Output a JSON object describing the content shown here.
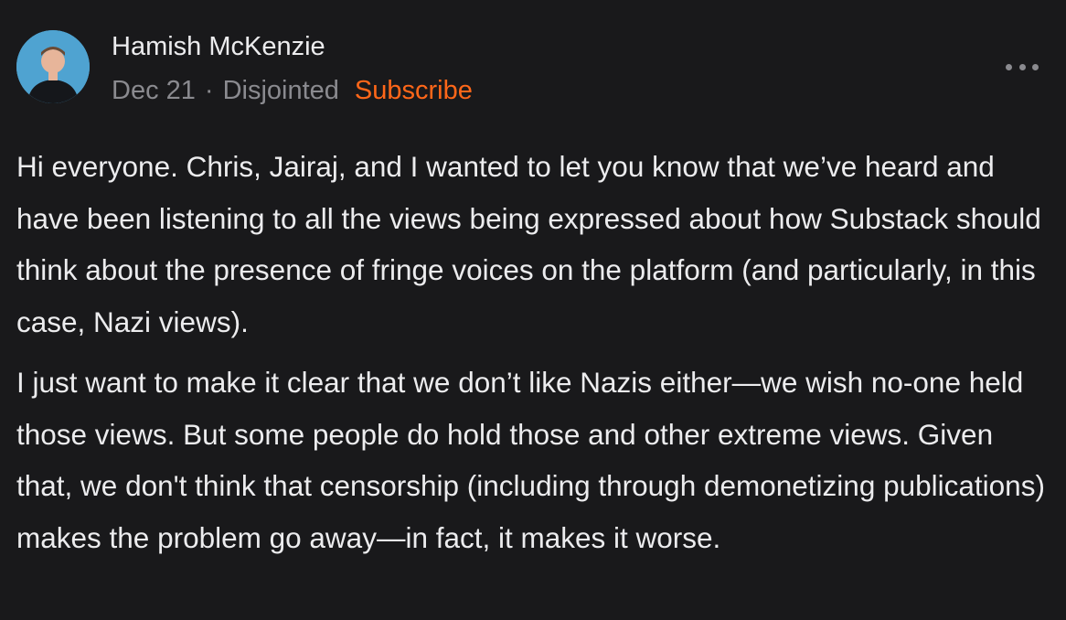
{
  "post": {
    "author": "Hamish McKenzie",
    "date": "Dec 21",
    "separator": "·",
    "publication": "Disjointed",
    "subscribe_label": "Subscribe",
    "more_icon": "more-horizontal-icon",
    "avatar_icon": "author-avatar",
    "paragraphs": [
      "Hi everyone. Chris, Jairaj, and I wanted to let you know that we’ve heard and have been listening to all the views being expressed about how Substack should think about the presence of fringe voices on the platform (and particularly, in this case, Nazi views).",
      "I just want to make it clear that we don’t like Nazis either—we wish no-one held those views. But some people do hold those and other extreme views. Given that, we don't think that censorship (including through demonetizing publications) makes the problem go away—in fact, it makes it worse."
    ]
  },
  "colors": {
    "background": "#19191b",
    "accent": "#ff6719",
    "muted": "#8a8a8f",
    "text": "#ececee"
  }
}
